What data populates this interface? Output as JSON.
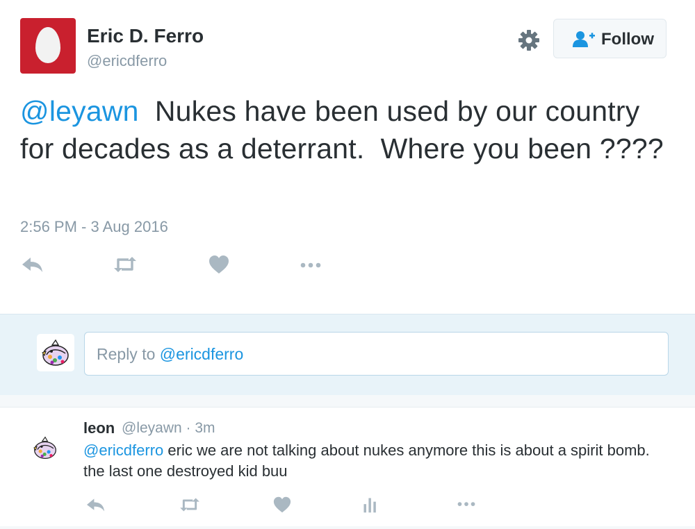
{
  "tweet": {
    "author_name": "Eric D. Ferro",
    "author_handle": "@ericdferro",
    "follow_label": "Follow",
    "text_mention": "@leyawn",
    "text_body": "  Nukes have been used by our country for decades as a deterrant.  Where you been ????",
    "timestamp": "2:56 PM - 3 Aug 2016",
    "avatar_color": "#c9202e",
    "actions": [
      "reply-icon",
      "retweet-icon",
      "like-icon",
      "more-icon"
    ]
  },
  "reply_box": {
    "prefix": "Reply to ",
    "mention": "@ericdferro"
  },
  "reply": {
    "name": "leon",
    "meta": "@leyawn · 3m",
    "text_mention": "@ericdferro",
    "text_body": " eric we are not talking about nukes anymore this is about a spirit bomb. the last one destroyed kid buu",
    "actions": [
      "reply-icon",
      "retweet-icon",
      "like-icon",
      "analytics-icon",
      "more-icon"
    ]
  },
  "colors": {
    "accent": "#1b95e0",
    "muted": "#8899a6",
    "icon": "#aab8c2",
    "reply_bar": "#e8f3f9"
  }
}
